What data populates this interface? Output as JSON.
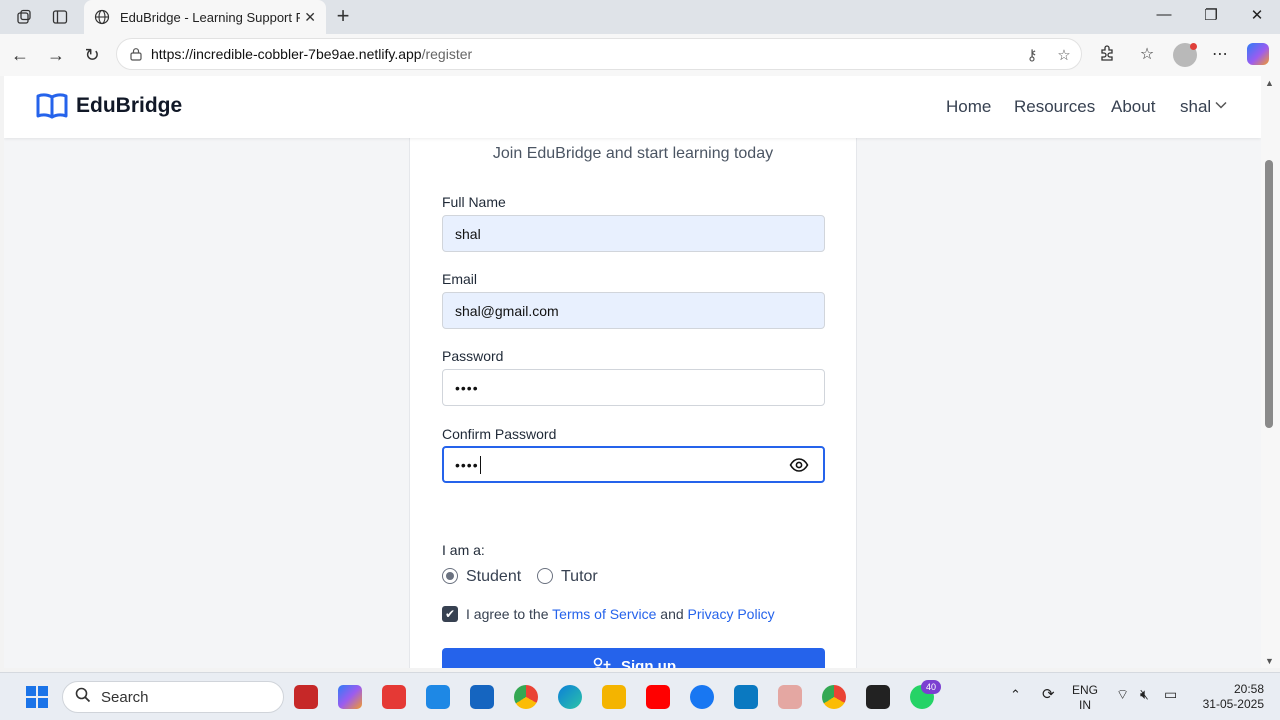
{
  "browser": {
    "tab_title": "EduBridge - Learning Support Pla",
    "url_host": "https://incredible-cobbler-7be9ae.netlify.app",
    "url_path": "/register"
  },
  "header": {
    "logo_text": "EduBridge",
    "nav": [
      "Home",
      "Resources",
      "About"
    ],
    "user_name": "shal"
  },
  "form": {
    "subtitle": "Join EduBridge and start learning today",
    "full_name_label": "Full Name",
    "full_name_value": "shal",
    "email_label": "Email",
    "email_value": "shal@gmail.com",
    "password_label": "Password",
    "password_value": "••••",
    "confirm_label": "Confirm Password",
    "confirm_value": "••••",
    "role_label": "I am a:",
    "roles": [
      "Student",
      "Tutor"
    ],
    "selected_role": "Student",
    "terms_prefix": "I agree to the",
    "terms_link": "Terms of Service",
    "terms_and": "and",
    "privacy_link": "Privacy Policy",
    "terms_checked": true,
    "submit_label": "Sign up",
    "accent_color": "#2563eb"
  },
  "taskbar": {
    "search_placeholder": "Search",
    "whatsapp_badge": "40",
    "lang_top": "ENG",
    "lang_bottom": "IN",
    "time": "20:58",
    "date": "31-05-2025"
  }
}
